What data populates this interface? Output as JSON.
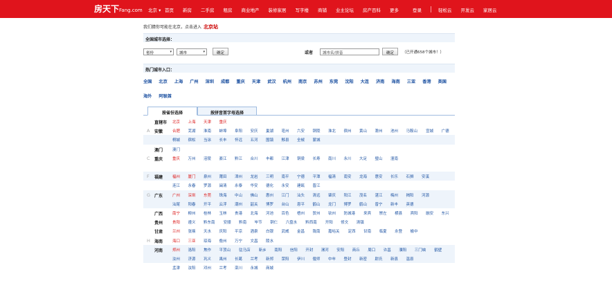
{
  "header": {
    "logo": "房天下",
    "logo_suffix": "Fang.com",
    "city": "北京",
    "nav": [
      "首页",
      "新房",
      "二手房",
      "租房",
      "商业地产",
      "装修家居",
      "写字楼",
      "商铺",
      "业主论坛",
      "房产百科",
      "更多"
    ],
    "right_nav": [
      "登录",
      "|",
      "轻松云",
      "开发云",
      "家居云"
    ]
  },
  "guess": {
    "prefix": "我们猜你可能在北京，点击进入",
    "city": "北京站"
  },
  "all_cities": {
    "title": "全国城市选择：",
    "province_select": "省份",
    "city_select": "城市",
    "confirm": "确定",
    "or_label": "或者",
    "search_placeholder": "城市名/拼音",
    "search_confirm": "确定",
    "note": "（已开通658个城市！）"
  },
  "hot_cities": {
    "title": "热门城市入口：",
    "row1": [
      "全国",
      "北京",
      "上海",
      "广州",
      "深圳",
      "成都",
      "重庆",
      "天津",
      "武汉",
      "杭州",
      "南京",
      "苏州",
      "东莞",
      "沈阳",
      "大连",
      "济南",
      "海南",
      "三亚",
      "香港",
      "英国"
    ],
    "row2": [
      "海外",
      "阿联酋"
    ]
  },
  "tabs": [
    "按省份选择",
    "按拼音首字母选择"
  ],
  "provinces": [
    {
      "letter": "",
      "name": "直辖市",
      "cities": [
        "北京",
        "上海",
        "天津",
        "重庆"
      ],
      "red": [
        0,
        1,
        2,
        3
      ]
    },
    {
      "letter": "A",
      "name": "安徽",
      "cities": [
        "合肥",
        "芜湖",
        "淮南",
        "蚌埠",
        "阜阳",
        "安庆",
        "巢湖",
        "亳州",
        "六安",
        "铜陵",
        "淮北",
        "宿州",
        "黄山",
        "滁州",
        "池州",
        "马鞍山",
        "宣城",
        "广德"
      ],
      "red": [
        0
      ]
    },
    {
      "letter": "",
      "name": "",
      "cities": [
        "桐城",
        "宿松",
        "当涂",
        "长丰",
        "怀远",
        "五河",
        "围镇",
        "黟县",
        "全椒",
        "蒙城"
      ],
      "red": []
    },
    {
      "letter": "",
      "name": "澳门",
      "cities": [
        "澳门"
      ],
      "red": []
    },
    {
      "letter": "C",
      "name": "重庆",
      "cities": [
        "重庆",
        "万州",
        "涪陵",
        "綦江",
        "黔江",
        "合川",
        "丰都",
        "江津",
        "铜梁",
        "长寿",
        "南川",
        "永川",
        "大足",
        "璧山",
        "潼南"
      ],
      "red": [
        0
      ]
    },
    {
      "letter": "F",
      "name": "福建",
      "cities": [
        "福州",
        "厦门",
        "泉州",
        "莆田",
        "漳州",
        "龙岩",
        "三明",
        "南平",
        "宁德",
        "平潭",
        "福清",
        "南安",
        "龙海",
        "惠安",
        "长乐",
        "石狮",
        "安溪"
      ],
      "red": [
        0,
        1
      ]
    },
    {
      "letter": "",
      "name": "",
      "cities": [
        "连江",
        "永春",
        "罗源",
        "闽清",
        "永泰",
        "华安",
        "德化",
        "永安",
        "建瓯",
        "晋江"
      ],
      "red": []
    },
    {
      "letter": "G",
      "name": "广东",
      "cities": [
        "广州",
        "深圳",
        "东莞",
        "珠海",
        "中山",
        "佛山",
        "惠州",
        "江门",
        "汕头",
        "清远",
        "肇庆",
        "阳江",
        "茂名",
        "湛江",
        "梅州",
        "揭阳",
        "河源"
      ],
      "red": [
        0,
        1,
        2
      ]
    },
    {
      "letter": "",
      "name": "",
      "cities": [
        "汕尾",
        "阳春",
        "开平",
        "云浮",
        "潮州",
        "韶关",
        "博罗",
        "台山",
        "恩平",
        "鹤山",
        "龙门",
        "博罗",
        "鹤山",
        "普宁",
        "新丰",
        "英德"
      ],
      "red": []
    },
    {
      "letter": "",
      "name": "广西",
      "cities": [
        "南宁",
        "柳州",
        "桂林",
        "玉林",
        "贵港",
        "北海",
        "河池",
        "百色",
        "梧州",
        "贺州",
        "钦州",
        "防城港",
        "来宾",
        "崇左",
        "横县",
        "宾阳",
        "融安",
        "东兴"
      ],
      "red": [
        0
      ]
    },
    {
      "letter": "",
      "name": "贵州",
      "cities": [
        "贵阳",
        "遵义",
        "黔东南",
        "安顺",
        "黔南",
        "毕节",
        "铜仁",
        "六盘水",
        "黔西南",
        "开阳",
        "修文",
        "清镇"
      ],
      "red": [
        0
      ]
    },
    {
      "letter": "",
      "name": "甘肃",
      "cities": [
        "兰州",
        "张掖",
        "天水",
        "庆阳",
        "平凉",
        "酒泉",
        "白银",
        "武威",
        "金昌",
        "陇南",
        "嘉峪关",
        "定西",
        "甘南",
        "临夏",
        "永登",
        "榆中"
      ],
      "red": [
        0
      ]
    },
    {
      "letter": "H",
      "name": "海南",
      "cities": [
        "海口",
        "三亚",
        "琼海",
        "儋州",
        "万宁",
        "文昌",
        "陵水"
      ],
      "red": [
        0,
        1
      ]
    },
    {
      "letter": "",
      "name": "河南",
      "cities": [
        "郑州",
        "洛阳",
        "焦作",
        "平顶山",
        "驻马店",
        "新乡",
        "南阳",
        "信阳",
        "开封",
        "漯河",
        "安阳",
        "商丘",
        "周口",
        "许昌",
        "濮阳",
        "三门峡",
        "鹤壁"
      ],
      "red": [
        0
      ]
    },
    {
      "letter": "",
      "name": "",
      "cities": [
        "汝州",
        "济源",
        "巩义",
        "禹州",
        "长葛",
        "兰考",
        "新郑",
        "荥阳",
        "伊川",
        "偃师",
        "中牟",
        "登封",
        "新密",
        "尉氏",
        "新县",
        "温县"
      ],
      "red": []
    },
    {
      "letter": "",
      "name": "",
      "cities": [
        "孟津",
        "汝阳",
        "邓州",
        "兰考",
        "栾川",
        "永城",
        "商城"
      ],
      "red": []
    }
  ]
}
